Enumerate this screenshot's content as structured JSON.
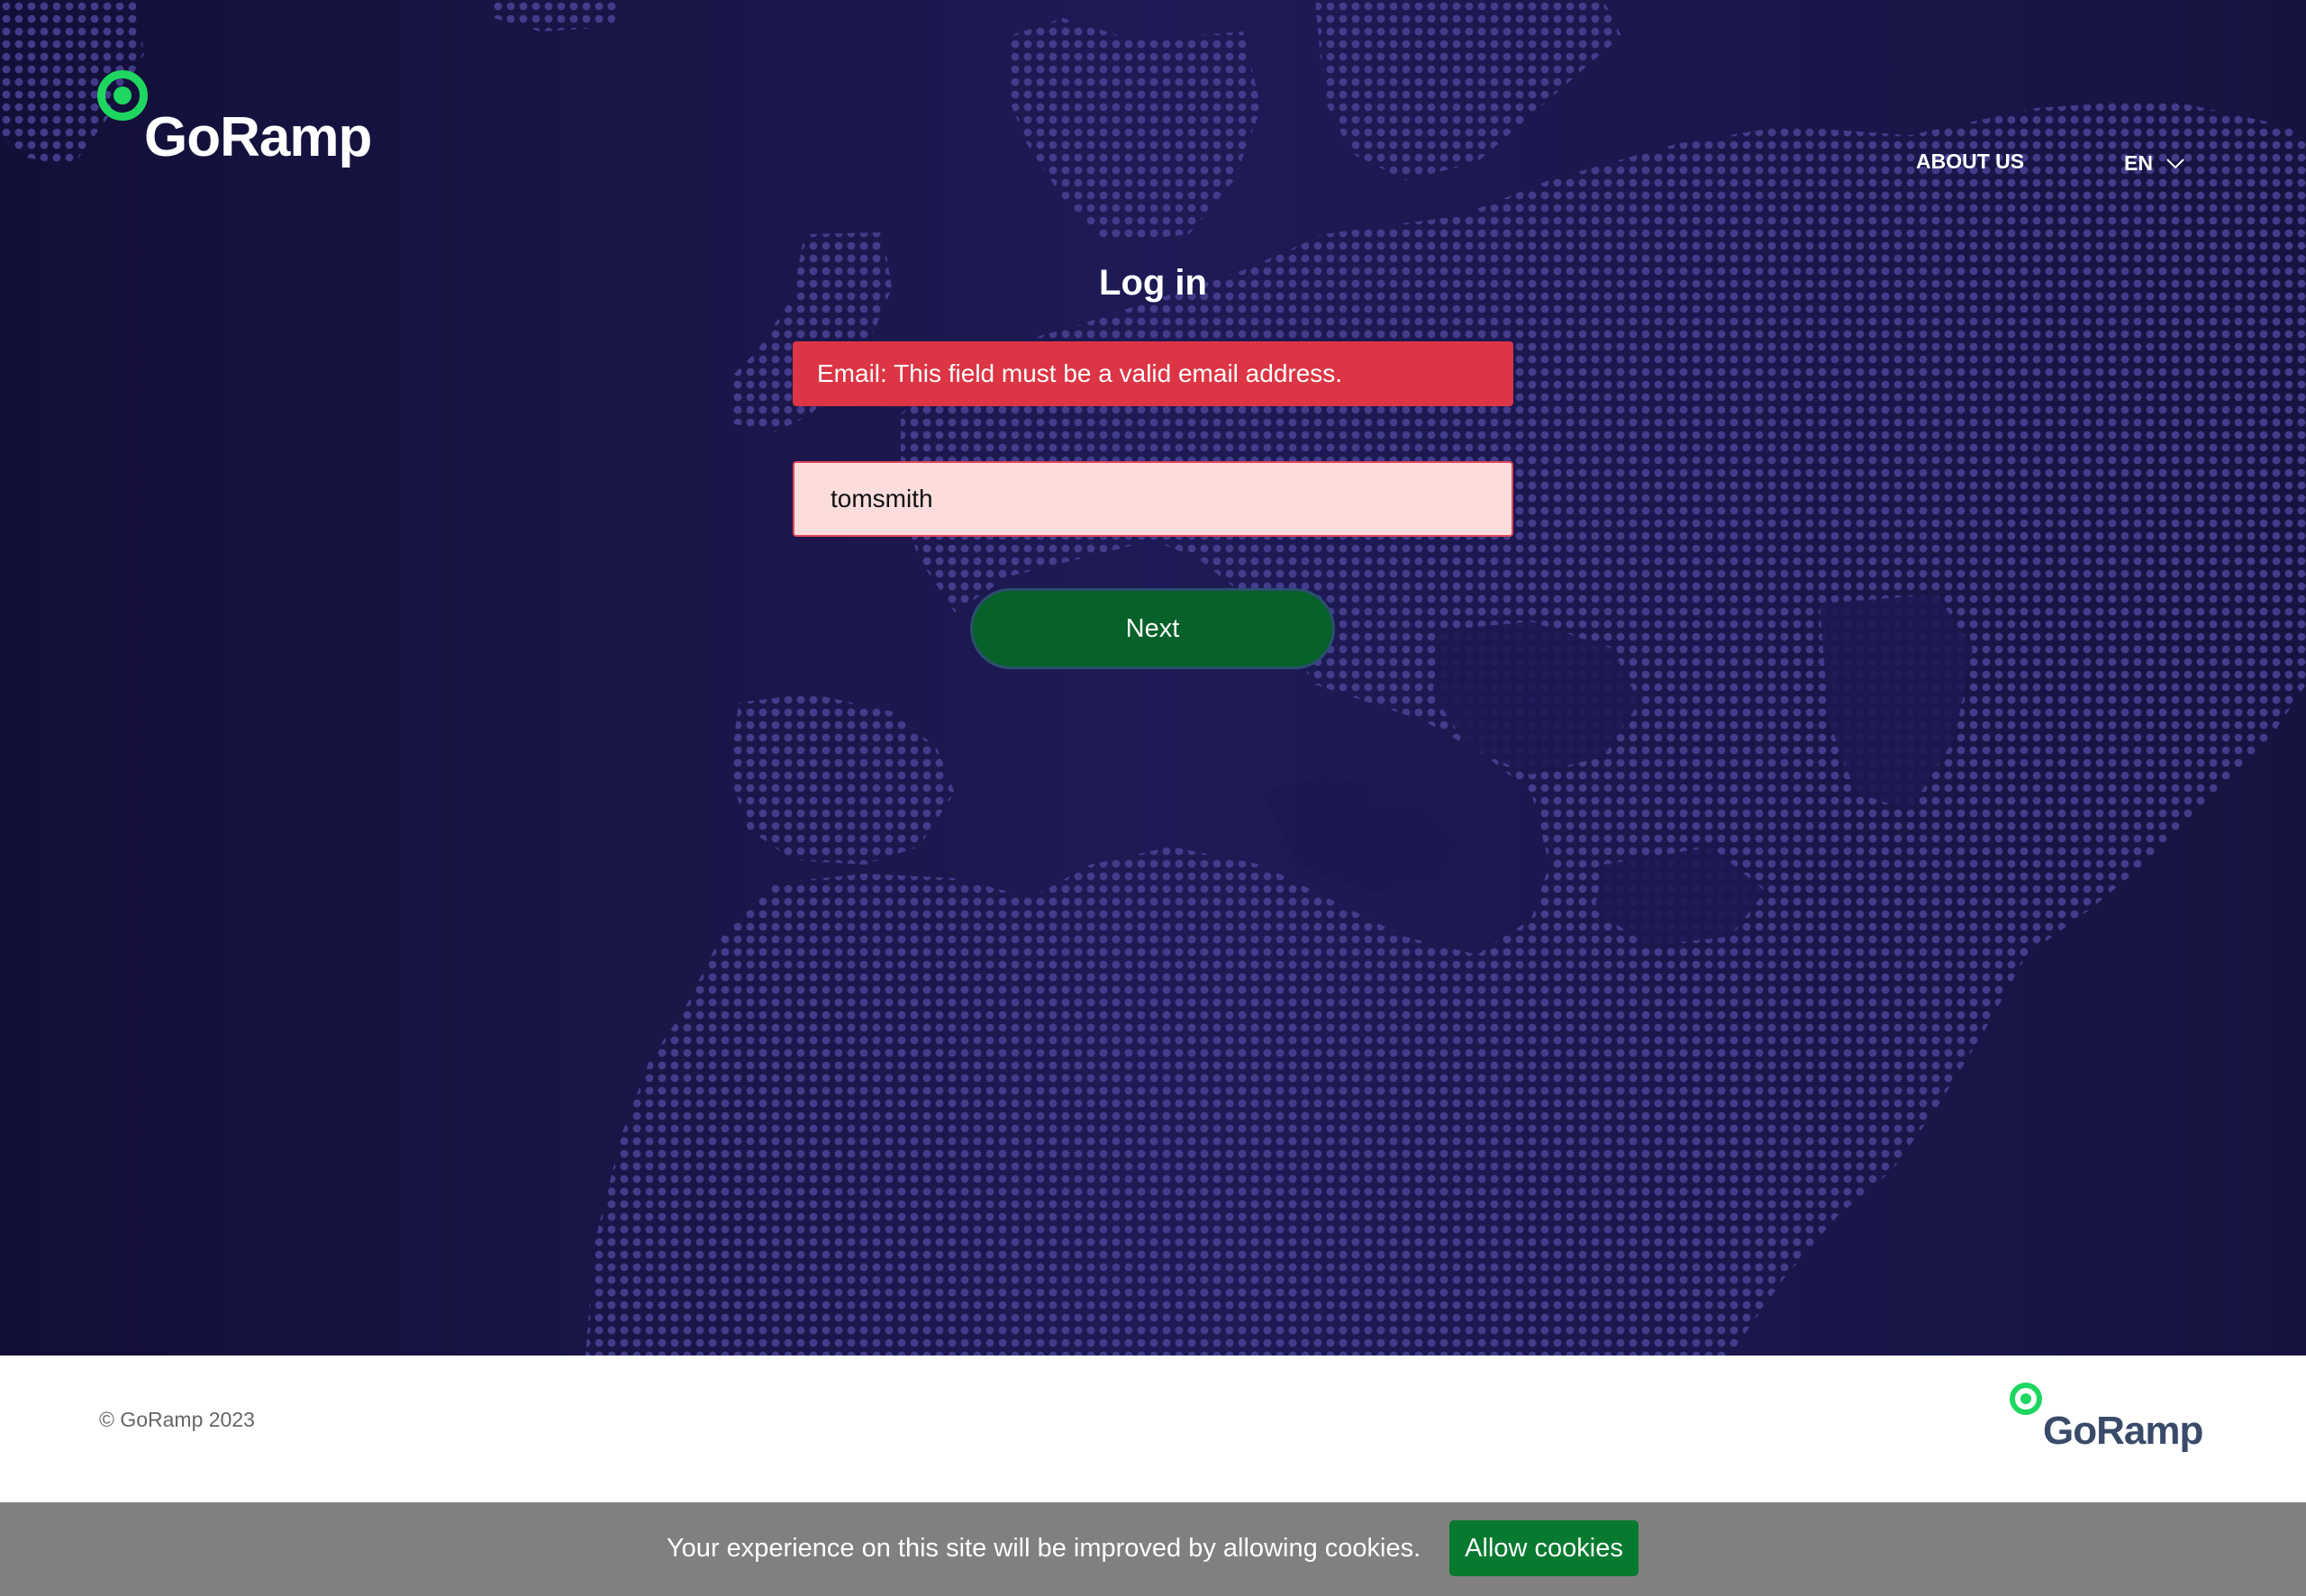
{
  "brand": {
    "name": "GoRamp",
    "accent_color": "#1ed760"
  },
  "header": {
    "about_label": "ABOUT US",
    "language": {
      "selected": "EN",
      "icon": "chevron-down-icon"
    }
  },
  "login": {
    "title": "Log in",
    "error_message": "Email: This field must be a valid email address.",
    "email_value": "tomsmith",
    "next_label": "Next"
  },
  "footer": {
    "copyright": "© GoRamp 2023"
  },
  "cookie_banner": {
    "message": "Your experience on this site will be improved by allowing cookies.",
    "button_label": "Allow cookies"
  },
  "colors": {
    "background": "#1b174c",
    "error": "#dc3545",
    "input_error_bg": "#fddcdc",
    "primary_button": "#06612a",
    "cookie_bar": "#808080",
    "cookie_button": "#077a2f"
  }
}
